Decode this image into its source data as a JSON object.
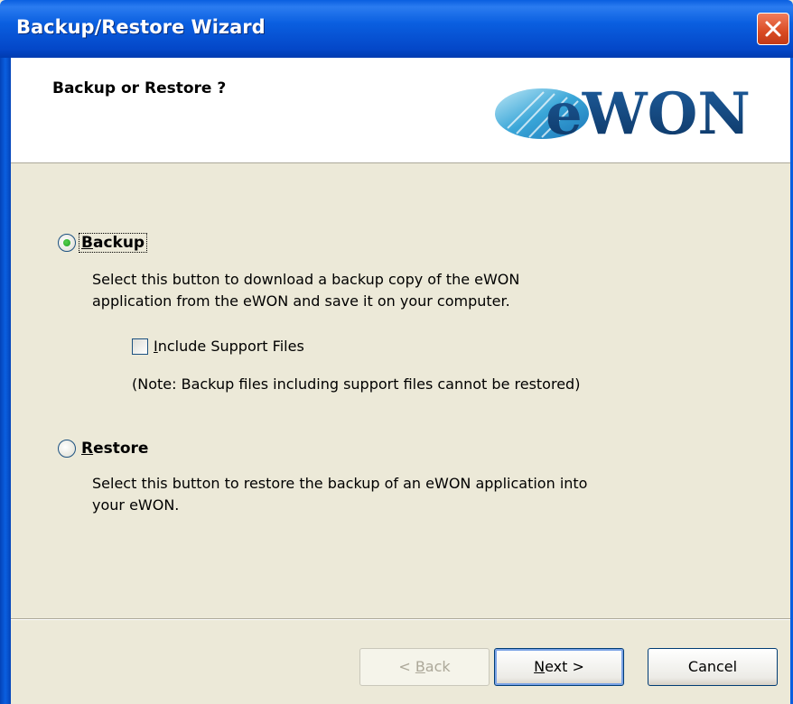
{
  "window": {
    "title": "Backup/Restore Wizard"
  },
  "header": {
    "title": "Backup or Restore ?",
    "logo_text": "eWON"
  },
  "options": {
    "backup": {
      "label_mnemonic": "B",
      "label_rest": "ackup",
      "selected": true,
      "description_line1": "Select this button to download a backup copy of the eWON",
      "description_line2": "application from the eWON and save it on your computer.",
      "include_support": {
        "label_mnemonic": "I",
        "label_rest": "nclude Support Files",
        "checked": false
      },
      "note": "(Note: Backup files including support files cannot be restored)"
    },
    "restore": {
      "label_mnemonic": "R",
      "label_rest": "estore",
      "selected": false,
      "description_line1": "Select this button to restore the backup of an eWON application into",
      "description_line2": "your eWON."
    }
  },
  "buttons": {
    "back_prefix": "< ",
    "back_mnemonic": "B",
    "back_rest": "ack",
    "next_mnemonic": "N",
    "next_rest": "ext >",
    "cancel": "Cancel"
  },
  "colors": {
    "titlebar": "#0a5fe0",
    "dialog_bg": "#ece9d8",
    "close": "#d94b22"
  }
}
